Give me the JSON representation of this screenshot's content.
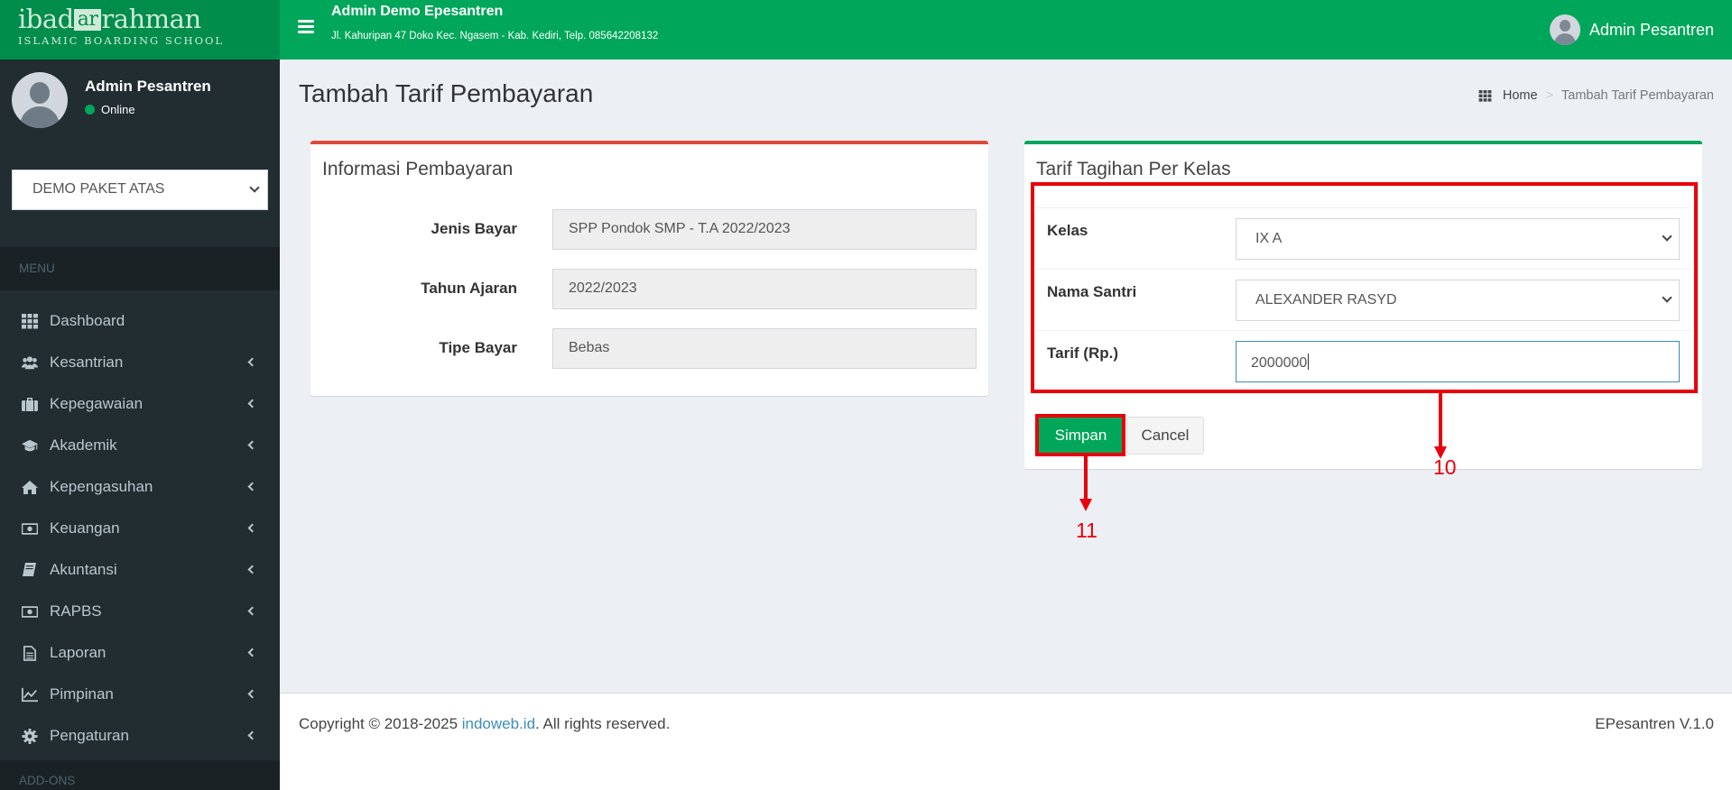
{
  "brand": {
    "logo_main_a": "ibad",
    "logo_main_box": "ar",
    "logo_main_b": "rahman",
    "logo_sub": "ISLAMIC BOARDING SCHOOL"
  },
  "header": {
    "school_name": "Admin Demo Epesantren",
    "school_address": "Jl. Kahuripan 47 Doko Kec. Ngasem - Kab. Kediri, Telp. 085642208132",
    "user_name": "Admin Pesantren"
  },
  "sidebar": {
    "user_name": "Admin Pesantren",
    "user_status": "Online",
    "package": "DEMO PAKET ATAS",
    "menu_header": "MENU",
    "items": [
      {
        "label": "Dashboard",
        "icon": "grid-icon",
        "has_caret": false
      },
      {
        "label": "Kesantrian",
        "icon": "users-icon",
        "has_caret": true
      },
      {
        "label": "Kepegawaian",
        "icon": "briefcase-icon",
        "has_caret": true
      },
      {
        "label": "Akademik",
        "icon": "graduation-cap-icon",
        "has_caret": true
      },
      {
        "label": "Kepengasuhan",
        "icon": "home-icon",
        "has_caret": true
      },
      {
        "label": "Keuangan",
        "icon": "money-icon",
        "has_caret": true
      },
      {
        "label": "Akuntansi",
        "icon": "book-icon",
        "has_caret": true
      },
      {
        "label": "RAPBS",
        "icon": "money-icon",
        "has_caret": true
      },
      {
        "label": "Laporan",
        "icon": "file-icon",
        "has_caret": true
      },
      {
        "label": "Pimpinan",
        "icon": "line-chart-icon",
        "has_caret": true
      },
      {
        "label": "Pengaturan",
        "icon": "gear-icon",
        "has_caret": true
      }
    ],
    "addons_header": "ADD-ONS"
  },
  "page": {
    "title": "Tambah Tarif Pembayaran",
    "breadcrumb_home": "Home",
    "breadcrumb_current": "Tambah Tarif Pembayaran"
  },
  "info_box": {
    "title": "Informasi Pembayaran",
    "fields": [
      {
        "label": "Jenis Bayar",
        "value": "SPP Pondok SMP - T.A 2022/2023"
      },
      {
        "label": "Tahun Ajaran",
        "value": "2022/2023"
      },
      {
        "label": "Tipe Bayar",
        "value": "Bebas"
      }
    ]
  },
  "tarif_box": {
    "title": "Tarif Tagihan Per Kelas",
    "kelas_label": "Kelas",
    "kelas_value": "IX A",
    "santri_label": "Nama Santri",
    "santri_value": "ALEXANDER RASYD",
    "tarif_label": "Tarif (Rp.)",
    "tarif_value": "2000000",
    "save_label": "Simpan",
    "cancel_label": "Cancel"
  },
  "annotations": {
    "form_marker": "10",
    "save_marker": "11",
    "color": "#e8000b"
  },
  "footer": {
    "copyright_prefix": "Copyright © 2018-2025 ",
    "copyright_link": "indoweb.id",
    "copyright_suffix": ". All rights reserved.",
    "version": "EPesantren V.1.0"
  },
  "colors": {
    "primary_green": "#00a65a",
    "logo_green": "#008d4c",
    "sidebar_bg": "#222d32",
    "danger_red": "#dd4b39",
    "link_blue": "#3c8dbc"
  }
}
